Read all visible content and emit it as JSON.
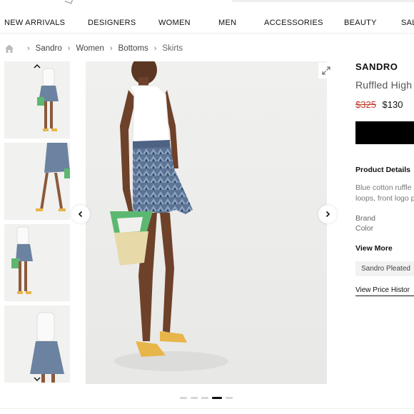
{
  "nav": {
    "items": [
      "NEW ARRIVALS",
      "DESIGNERS",
      "WOMEN",
      "MEN",
      "ACCESSORIES",
      "BEAUTY",
      "SAL"
    ]
  },
  "breadcrumb": {
    "home_icon": "home-icon",
    "items": [
      "Sandro",
      "Women",
      "Bottoms",
      "Skirts"
    ]
  },
  "gallery": {
    "expand_icon": "expand-icon",
    "prev_icon": "chevron-left-icon",
    "next_icon": "chevron-right-icon",
    "thumb_up_icon": "chevron-up-icon",
    "thumb_down_icon": "chevron-down-icon",
    "dots_count": 5,
    "active_dot": 4
  },
  "product": {
    "brand": "SANDRO",
    "title": "Ruffled High",
    "old_price": "$325",
    "new_price": "$130",
    "details_title": "Product Details",
    "description": "Blue cotton ruffle belt loops, front logo print.",
    "attr_brand": "Brand",
    "attr_color": "Color",
    "view_more": "View More",
    "chip": "Sandro Pleated",
    "price_history": "View Price Histor"
  },
  "colors": {
    "old_price": "#c0392b",
    "button": "#000000",
    "skirt": "#5d7494",
    "bag_green": "#5cb870",
    "bag_tan": "#e8d9a8",
    "sandal": "#e8b54a"
  }
}
